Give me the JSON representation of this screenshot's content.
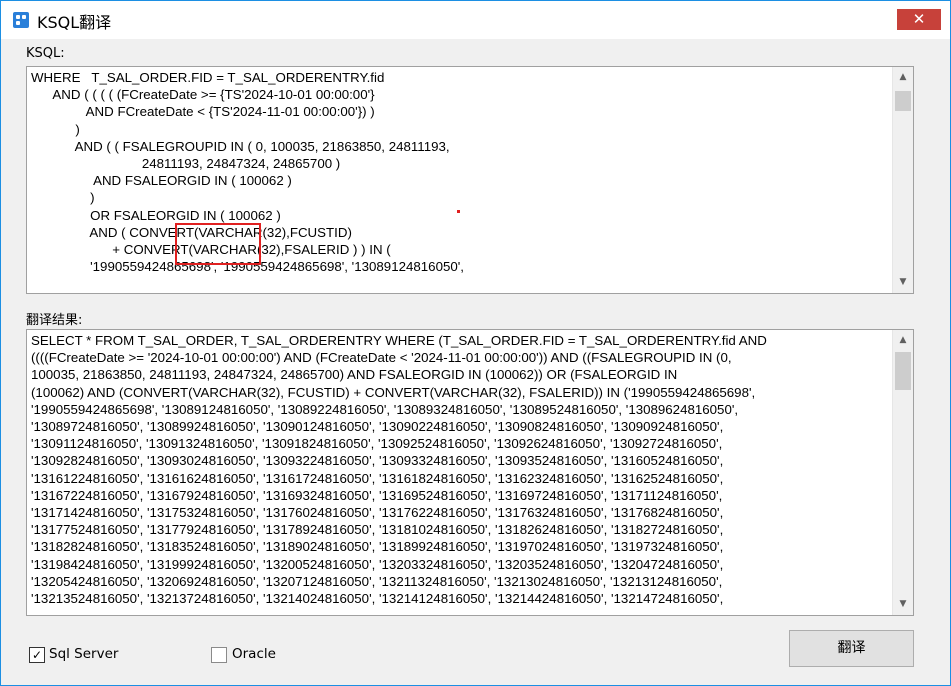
{
  "window": {
    "title": "KSQL翻译",
    "close_glyph": "✕"
  },
  "ksql": {
    "label": "KSQL:",
    "code": "WHERE   T_SAL_ORDER.FID = T_SAL_ORDERENTRY.fid\n      AND ( ( ( ( (FCreateDate >= {TS'2024-10-01 00:00:00'}\n               AND FCreateDate < {TS'2024-11-01 00:00:00'}) )\n            )\n            AND ( ( FSALEGROUPID IN ( 0, 100035, 21863850, 24811193,\n                              24811193, 24847324, 24865700 )\n                 AND FSALEORGID IN ( 100062 )\n                )\n                OR FSALEORGID IN ( 100062 )\n                AND ( CONVERT(VARCHAR(32),FCUSTID)\n                      + CONVERT(VARCHAR(32),FSALERID ) ) IN (\n                '1990559424865698', '1990559424865698', '13089124816050',"
  },
  "result": {
    "label": "翻译结果:",
    "text": "SELECT * FROM T_SAL_ORDER, T_SAL_ORDERENTRY WHERE (T_SAL_ORDER.FID = T_SAL_ORDERENTRY.fid AND\n((((FCreateDate >= '2024-10-01 00:00:00') AND (FCreateDate < '2024-11-01 00:00:00')) AND ((FSALEGROUPID IN (0,\n100035, 21863850, 24811193, 24847324, 24865700) AND FSALEORGID IN (100062)) OR (FSALEORGID IN\n(100062) AND (CONVERT(VARCHAR(32), FCUSTID) + CONVERT(VARCHAR(32), FSALERID)) IN ('1990559424865698',\n'1990559424865698', '13089124816050', '13089224816050', '13089324816050', '13089524816050', '13089624816050',\n'13089724816050', '13089924816050', '13090124816050', '13090224816050', '13090824816050', '13090924816050',\n'13091124816050', '13091324816050', '13091824816050', '13092524816050', '13092624816050', '13092724816050',\n'13092824816050', '13093024816050', '13093224816050', '13093324816050', '13093524816050', '13160524816050',\n'13161224816050', '13161624816050', '13161724816050', '13161824816050', '13162324816050', '13162524816050',\n'13167224816050', '13167924816050', '13169324816050', '13169524816050', '13169724816050', '13171124816050',\n'13171424816050', '13175324816050', '13176024816050', '13176224816050', '13176324816050', '13176824816050',\n'13177524816050', '13177924816050', '13178924816050', '13181024816050', '13182624816050', '13182724816050',\n'13182824816050', '13183524816050', '13189024816050', '13189924816050', '13197024816050', '13197324816050',\n'13198424816050', '13199924816050', '13200524816050', '13203324816050', '13203524816050', '13204724816050',\n'13205424816050', '13206924816050', '13207124816050', '13211324816050', '13213024816050', '13213124816050',\n'13213524816050', '13213724816050', '13214024816050', '13214124816050', '13214424816050', '13214724816050',"
  },
  "options": {
    "sqlserver_label": "Sql Server",
    "sqlserver_checked": true,
    "oracle_label": "Oracle",
    "oracle_checked": false,
    "check_glyph": "✓"
  },
  "buttons": {
    "translate_label": "翻译"
  },
  "colors": {
    "accent": "#1c8fe3",
    "close_bg": "#c7413a",
    "highlight": "#e02020"
  }
}
